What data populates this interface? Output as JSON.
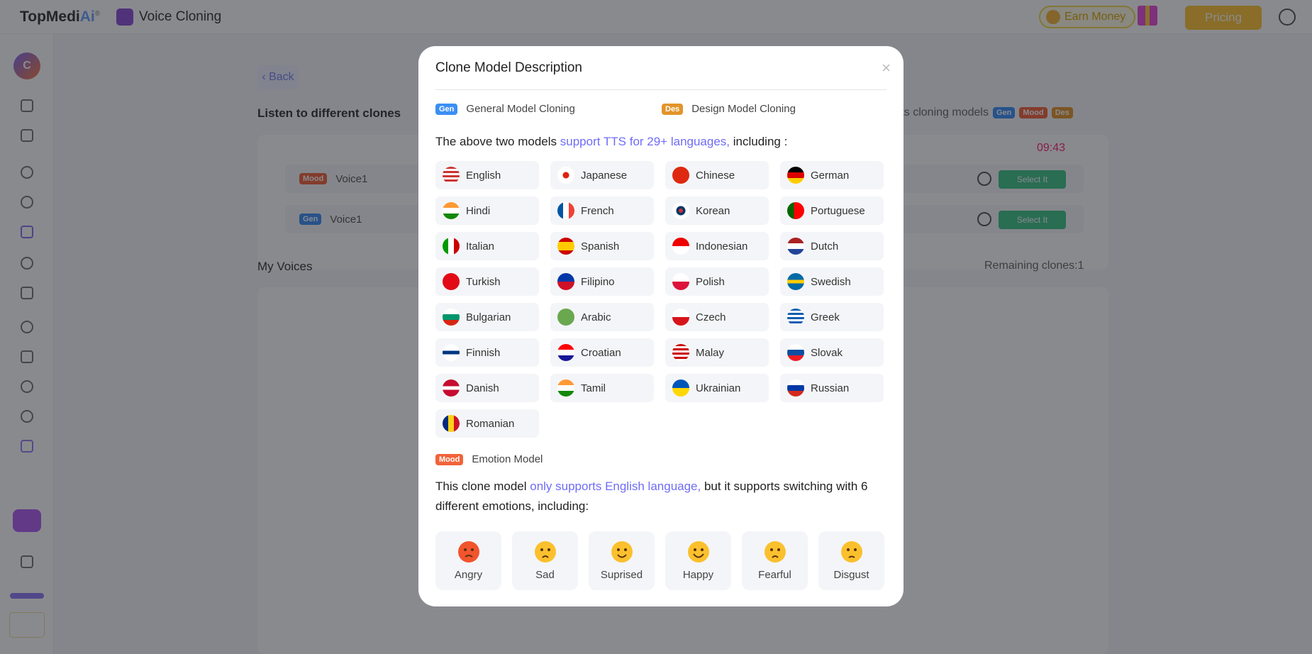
{
  "header": {
    "logo_main": "TopMedi",
    "logo_ai": "Ai",
    "logo_mark": "®",
    "app_name": "Voice Cloning",
    "earn_money": "Earn Money",
    "pricing": "Pricing"
  },
  "sidebar": {
    "avatar_letter": "C"
  },
  "page": {
    "back": "Back",
    "listen_text": "Listen to different clones",
    "models_text": "rts cloning models",
    "tags": {
      "gen": "Gen",
      "mood": "Mood",
      "des": "Des"
    },
    "time": "09:43",
    "voices": [
      {
        "tag": "Mood",
        "name": "Voice1",
        "select": "Select It"
      },
      {
        "tag": "Gen",
        "name": "Voice1",
        "select": "Select It"
      }
    ],
    "my_voices": "My Voices",
    "remaining": "Remaining clones:1"
  },
  "modal": {
    "title": "Clone Model Description",
    "close": "×",
    "gen_tag": "Gen",
    "gen_label": "General Model Cloning",
    "des_tag": "Des",
    "des_label": "Design Model Cloning",
    "tts_pre": "The above two models ",
    "tts_hl": "support TTS for 29+ languages,",
    "tts_post": " including :",
    "languages": [
      "English",
      "Japanese",
      "Chinese",
      "German",
      "Hindi",
      "French",
      "Korean",
      "Portuguese",
      "Italian",
      "Spanish",
      "Indonesian",
      "Dutch",
      "Turkish",
      "Filipino",
      "Polish",
      "Swedish",
      "Bulgarian",
      "Arabic",
      "Czech",
      "Greek",
      "Finnish",
      "Croatian",
      "Malay",
      "Slovak",
      "Danish",
      "Tamil",
      "Ukrainian",
      "Russian",
      "Romanian"
    ],
    "mood_tag": "Mood",
    "mood_label": "Emotion Model",
    "emo_pre": "This clone model ",
    "emo_hl": "only supports English language,",
    "emo_post": " but it supports switching with 6 different emotions, including:",
    "emotions": [
      {
        "label": "Angry",
        "color": "#f2542d"
      },
      {
        "label": "Sad",
        "color": "#fbc02d"
      },
      {
        "label": "Suprised",
        "color": "#fbc02d"
      },
      {
        "label": "Happy",
        "color": "#fbc02d"
      },
      {
        "label": "Fearful",
        "color": "#fbc02d"
      },
      {
        "label": "Disgust",
        "color": "#fbc02d"
      }
    ]
  },
  "colors": {
    "accent": "#6f6cf6",
    "gen": "#3b8ff5",
    "mood": "#f2633a",
    "des": "#e3942a",
    "select": "#3ec487",
    "pricing": "#ffc534"
  }
}
